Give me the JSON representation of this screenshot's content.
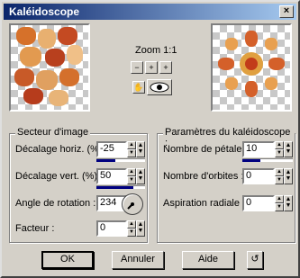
{
  "window": {
    "title": "Kaléidoscope",
    "close_glyph": "×"
  },
  "zoom": {
    "label": "Zoom 1:1",
    "zoom_out_icon": "zoom-out-icon",
    "fit_icon": "fit-icon",
    "zoom_in_icon": "zoom-in-icon",
    "hand_icon": "hand-icon",
    "eye_icon": "eye-icon"
  },
  "image_sector": {
    "legend": "Secteur d'image",
    "h_offset": {
      "label": "Décalage horiz. (%) :",
      "value": "-25"
    },
    "v_offset": {
      "label": "Décalage vert. (%) :",
      "value": "50"
    },
    "rotation": {
      "label": "Angle de rotation :",
      "value": "234"
    },
    "factor": {
      "label": "Facteur :",
      "value": "0"
    }
  },
  "kaleido_params": {
    "legend": "Paramètres du kaléidoscope :",
    "petals": {
      "label": "Nombre de pétales :",
      "value": "10"
    },
    "orbits": {
      "label": "Nombre d'orbites :",
      "value": "0"
    },
    "radial_suction": {
      "label": "Aspiration radiale :",
      "value": "0"
    }
  },
  "buttons": {
    "ok": "OK",
    "cancel": "Annuler",
    "help": "Aide",
    "reset_icon": "reset-icon"
  },
  "colors": {
    "title_start": "#0a246a",
    "title_end": "#a6caf0",
    "track_fill": "#000080"
  }
}
